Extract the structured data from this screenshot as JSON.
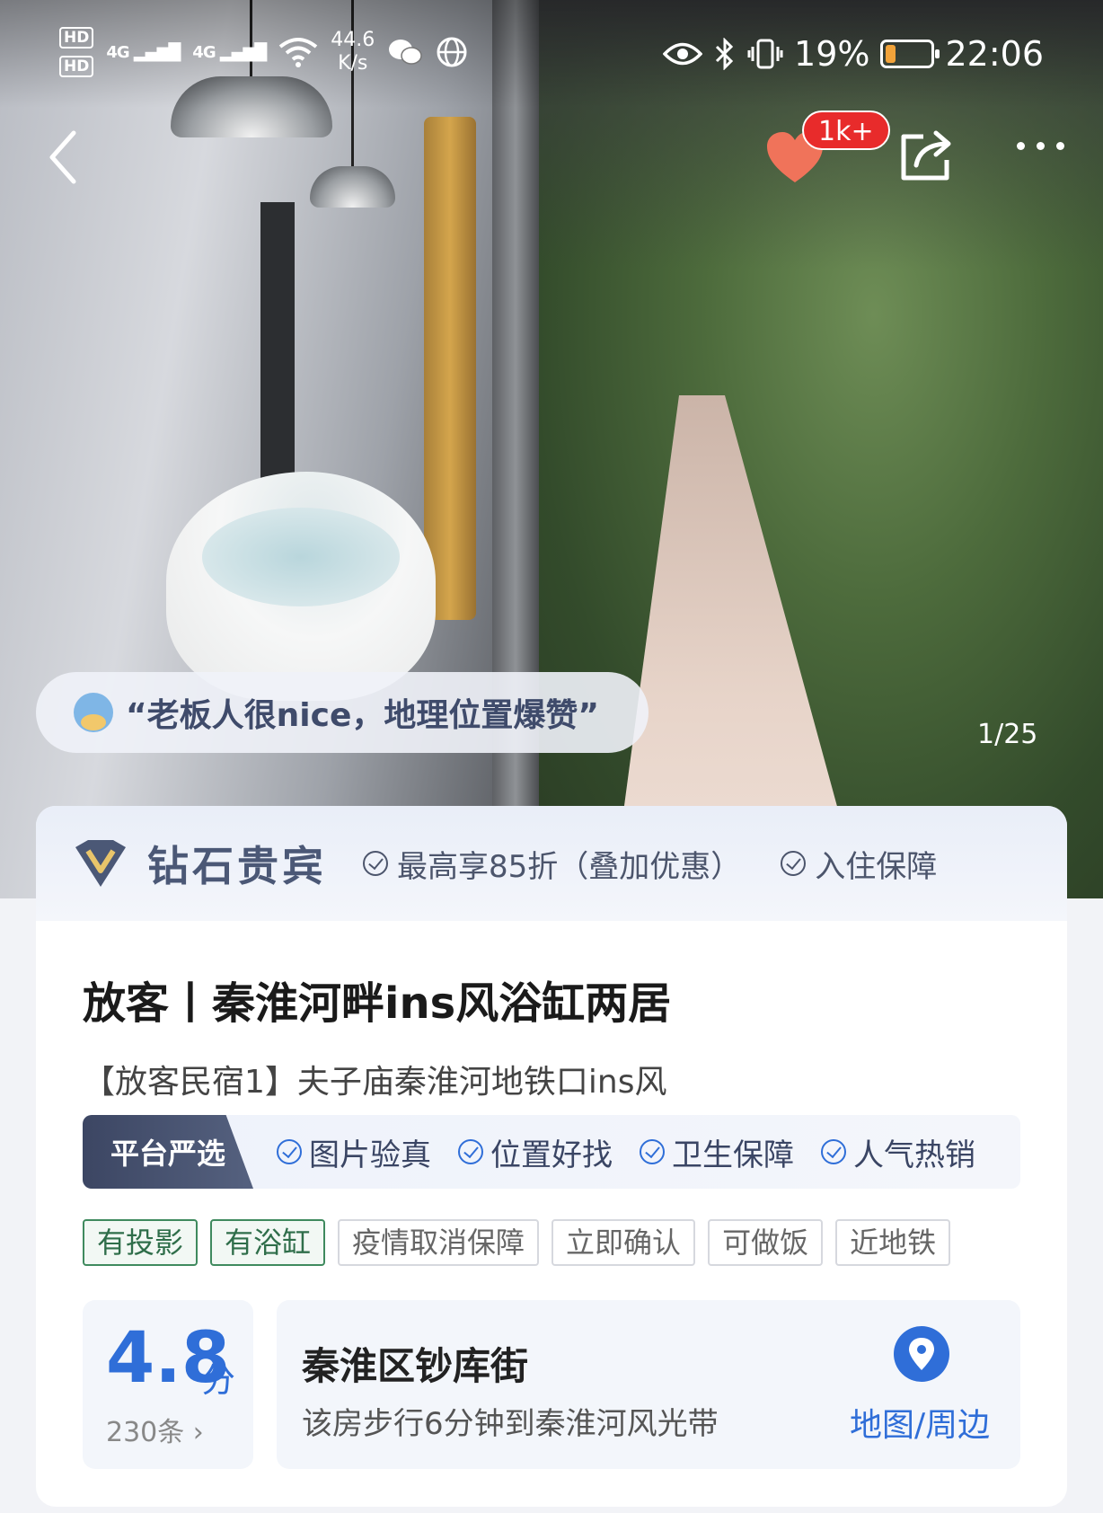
{
  "status_bar": {
    "hd1": "HD",
    "hd2": "HD",
    "signal1": "4G",
    "signal2": "4G",
    "speed_value": "44.6",
    "speed_unit": "K/s",
    "battery_percent": "19%",
    "battery_level": 0.19,
    "time": "22:06"
  },
  "nav": {
    "favorites_badge": "1k+"
  },
  "hero": {
    "review_quote": "“老板人很nice，地理位置爆赞”",
    "photo_counter": "1/25"
  },
  "vip": {
    "title": "钻石贵宾",
    "perks": [
      "最高享85折（叠加优惠）",
      "入住保障"
    ]
  },
  "listing": {
    "title": "放客丨秦淮河畔ins风浴缸两居",
    "subtitle": "【放客民宿1】夫子庙秦淮河地铁口ins风"
  },
  "platform": {
    "label": "平台严选",
    "items": [
      "图片验真",
      "位置好找",
      "卫生保障",
      "人气热销"
    ]
  },
  "chips": [
    "有投影",
    "有浴缸",
    "疫情取消保障",
    "立即确认",
    "可做饭",
    "近地铁"
  ],
  "rating": {
    "score": "4.8",
    "unit": "分",
    "review_count": "230条 ›"
  },
  "location": {
    "name": "秦淮区钞库街",
    "description": "该房步行6分钟到秦淮河风光带",
    "map_link": "地图/周边"
  },
  "colors": {
    "accent": "#2f6ed8",
    "badge": "#e82b2b",
    "heart": "#f0735a",
    "vip": "#4b5876"
  }
}
